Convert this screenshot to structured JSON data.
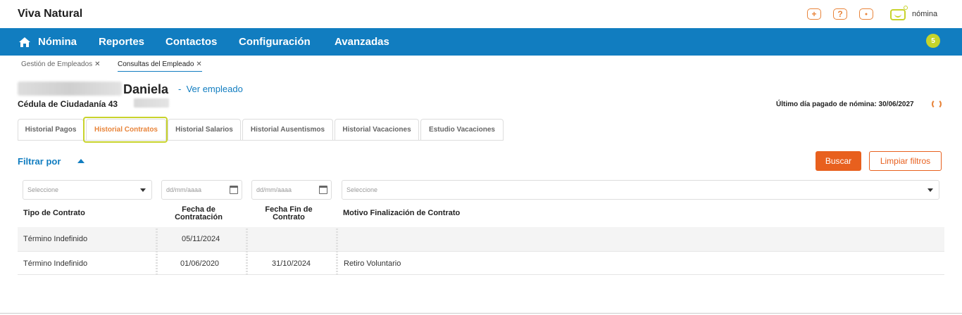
{
  "app": {
    "title": "Viva Natural",
    "logo_text": "nómina"
  },
  "top_icons": [
    {
      "name": "add-icon",
      "glyph": "+"
    },
    {
      "name": "help-icon",
      "glyph": "?"
    },
    {
      "name": "user-icon",
      "glyph": "●"
    }
  ],
  "nav": {
    "items": [
      "Nómina",
      "Reportes",
      "Contactos",
      "Configuración",
      "Avanzadas"
    ],
    "badge": "5"
  },
  "breadcrumbs": [
    {
      "label": "Gestión de Empleados",
      "close": "✕"
    },
    {
      "label": "Consultas del Empleado",
      "close": "✕"
    }
  ],
  "employee": {
    "name": "Daniela",
    "separator": "-",
    "view_link": "Ver empleado",
    "id_label": "Cédula de Ciudadanía 43",
    "last_paid": "Último día pagado de nómina: 30/06/2027"
  },
  "tabs": [
    "Historial Pagos",
    "Historial Contratos",
    "Historial Salarios",
    "Historial Ausentismos",
    "Historial Vacaciones",
    "Estudio Vacaciones"
  ],
  "active_tab": "Historial Contratos",
  "filter": {
    "label": "Filtrar por",
    "search_button": "Buscar",
    "clear_button": "Limpiar filtros",
    "contract_type_placeholder": "Seleccione",
    "start_date_placeholder": "dd/mm/aaaa",
    "end_date_placeholder": "dd/mm/aaaa",
    "reason_placeholder": "Seleccione"
  },
  "table": {
    "headers": {
      "tipo": "Tipo de Contrato",
      "fecha_ini_1": "Fecha de",
      "fecha_ini_2": "Contratación",
      "fecha_fin_1": "Fecha Fin de",
      "fecha_fin_2": "Contrato",
      "motivo": "Motivo Finalización de Contrato"
    },
    "rows": [
      {
        "tipo": "Término Indefinido",
        "inicio": "05/11/2024",
        "fin": "",
        "motivo": ""
      },
      {
        "tipo": "Término Indefinido",
        "inicio": "01/06/2020",
        "fin": "31/10/2024",
        "motivo": "Retiro Voluntario"
      }
    ]
  },
  "colors": {
    "primary": "#117dc0",
    "accent": "#e8601e",
    "highlight": "#c8d32c"
  }
}
